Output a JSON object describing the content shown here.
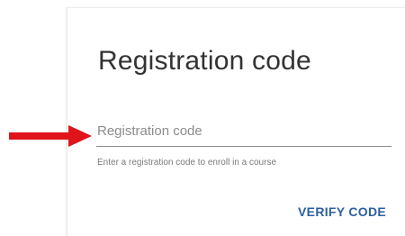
{
  "card": {
    "title": "Registration code"
  },
  "registration_field": {
    "placeholder": "Registration code",
    "value": "",
    "helper_text": "Enter a registration code to enroll in a course"
  },
  "actions": {
    "verify_label": "VERIFY CODE"
  },
  "annotation": {
    "arrow_color": "#e0141b",
    "icon": "red-arrow-icon"
  },
  "colors": {
    "accent": "#2b5fa0",
    "text": "#333333",
    "muted": "#7a7a7a"
  }
}
